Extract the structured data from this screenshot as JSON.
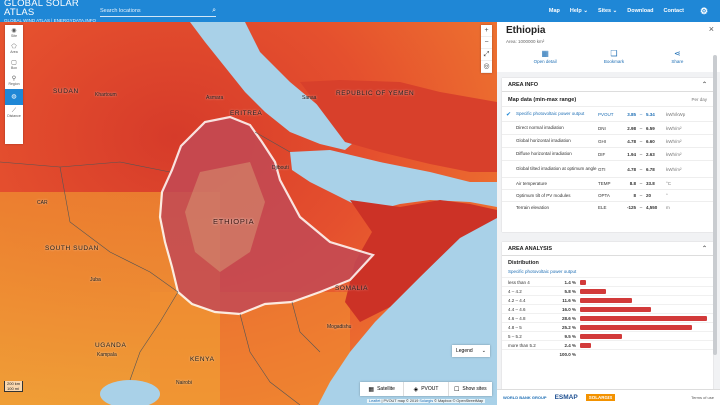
{
  "header": {
    "brand_title": "GLOBAL SOLAR ATLAS",
    "brand_sub": "GLOBAL WIND ATLAS  |  ENERGYDATA.INFO",
    "search_placeholder": "Search locations",
    "nav": [
      "Map",
      "Help ⌄",
      "Sites ⌄",
      "Download",
      "Contact"
    ],
    "settings_icon": "gear-icon"
  },
  "map": {
    "tools": [
      {
        "label": "Site",
        "icon": "pin-icon"
      },
      {
        "label": "Area",
        "icon": "polygon-icon"
      },
      {
        "label": "Box",
        "icon": "box-icon"
      },
      {
        "label": "Region",
        "icon": "region-icon"
      },
      {
        "label": "",
        "icon": "globe-icon"
      },
      {
        "label": "Distance",
        "icon": "ruler-icon"
      }
    ],
    "zoom": [
      "+",
      "−",
      "⤢",
      "◎"
    ],
    "labels": {
      "sudan": "SUDAN",
      "khartoum": "Khartoum",
      "asmara": "Asmara",
      "eritrea": "ERITREA",
      "sanaa": "Sanaa",
      "yemen": "REPUBLIC OF YEMEN",
      "djibouti": "Djibouti",
      "ethiopia": "ETHIOPIA",
      "south_sudan": "SOUTH SUDAN",
      "juba": "Juba",
      "somalia": "SOMALIA",
      "mogadishu": "Mogadishu",
      "uganda": "UGANDA",
      "kampala": "Kampala",
      "kenya": "KENYA",
      "nairobi": "Nairobi",
      "cair": "CAR"
    },
    "scale": [
      "200 km",
      "100 mi"
    ],
    "legend_label": "Legend",
    "layers": [
      {
        "label": "Satellite",
        "icon": "satellite-icon"
      },
      {
        "label": "PVOUT",
        "icon": "layers-icon"
      },
      {
        "label": "Show sites",
        "icon": "pin-icon"
      }
    ],
    "attribution_leaflet": "Leaflet",
    "attribution_text": " | PVOUT map © 2019 ",
    "attribution_solargis": "Solargis",
    "attribution_rest": " © Mapbox © OpenStreetMap"
  },
  "panel": {
    "title": "Ethiopia",
    "area": "Area: 1000000 km²",
    "actions": [
      {
        "label": "Open detail",
        "icon": "grid-icon"
      },
      {
        "label": "Bookmark",
        "icon": "bookmark-icon"
      },
      {
        "label": "Share",
        "icon": "share-icon"
      }
    ],
    "area_info": {
      "heading": "AREA INFO",
      "subheading": "Map data (min-max range)",
      "per": "Per day",
      "rows": [
        {
          "name": "Specific photovoltaic power output",
          "abbr": "PVOUT",
          "min": "3.85",
          "sep": "–",
          "max": "5.34",
          "unit": "kWh/kWp",
          "selected": true
        },
        {
          "name": "Direct normal irradiation",
          "abbr": "DNI",
          "min": "2.98",
          "sep": "–",
          "max": "6.59",
          "unit": "kWh/m²",
          "selected": false
        },
        {
          "name": "Global horizontal irradiation",
          "abbr": "GHI",
          "min": "4.78",
          "sep": "–",
          "max": "6.60",
          "unit": "kWh/m²",
          "selected": false
        },
        {
          "name": "Diffuse horizontal irradiation",
          "abbr": "DIF",
          "min": "1.94",
          "sep": "–",
          "max": "2.63",
          "unit": "kWh/m²",
          "selected": false
        },
        {
          "name": "Global tilted irradiation at optimum angle",
          "abbr": "GTI",
          "min": "4.78",
          "sep": "–",
          "max": "6.78",
          "unit": "kWh/m²",
          "selected": false
        },
        {
          "name": "Air temperature",
          "abbr": "TEMP",
          "min": "8.8",
          "sep": "–",
          "max": "33.8",
          "unit": "°C",
          "selected": false
        },
        {
          "name": "Optimum tilt of PV modules",
          "abbr": "OPTA",
          "min": "8",
          "sep": "–",
          "max": "20",
          "unit": "°",
          "selected": false
        },
        {
          "name": "Terrain elevation",
          "abbr": "ELE",
          "min": "-125",
          "sep": "–",
          "max": "4,550",
          "unit": "m",
          "selected": false
        }
      ]
    },
    "area_analysis": {
      "heading": "AREA ANALYSIS",
      "dist_title": "Distribution",
      "dist_sub": "Specific photovoltaic power output",
      "rows": [
        {
          "label": "less than 4",
          "pct": "1.4 %",
          "value": 1.4
        },
        {
          "label": "4 – 4.2",
          "pct": "5.8 %",
          "value": 5.8
        },
        {
          "label": "4.2 – 4.4",
          "pct": "11.6 %",
          "value": 11.6
        },
        {
          "label": "4.4 – 4.6",
          "pct": "16.0 %",
          "value": 16.0
        },
        {
          "label": "4.6 – 4.8",
          "pct": "28.6 %",
          "value": 28.6
        },
        {
          "label": "4.8 – 5",
          "pct": "25.2 %",
          "value": 25.2
        },
        {
          "label": "5 – 5.2",
          "pct": "9.5 %",
          "value": 9.5
        },
        {
          "label": "more than 5.2",
          "pct": "2.4 %",
          "value": 2.4
        },
        {
          "label": "",
          "pct": "100.0 %",
          "value": 0
        }
      ]
    }
  },
  "footer": {
    "worldbank": "WORLD BANK GROUP",
    "esmap": "ESMAP",
    "solargis": "SOLARGIS",
    "terms": "Terms of use"
  },
  "colors": {
    "brand_blue": "#1f87d6",
    "bar_red": "#d23a3a"
  }
}
